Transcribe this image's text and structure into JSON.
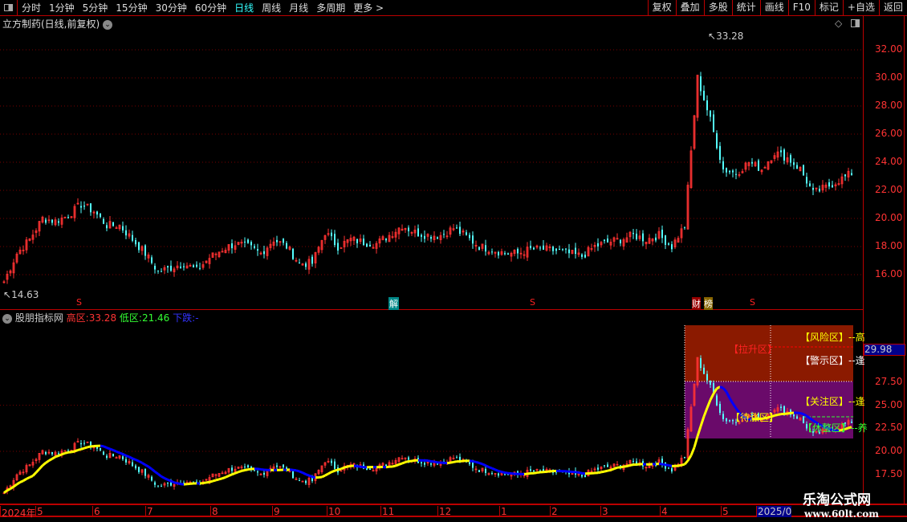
{
  "toolbar": {
    "periods": [
      "分时",
      "1分钟",
      "5分钟",
      "15分钟",
      "30分钟",
      "60分钟",
      "日线",
      "周线",
      "月线",
      "多周期",
      "更多 >"
    ],
    "active": "日线",
    "buttons": [
      "复权",
      "叠加",
      "多股",
      "统计",
      "画线",
      "F10",
      "标记",
      "+自选",
      "返回"
    ]
  },
  "main": {
    "title": "立方制药(日线,前复权)",
    "high_label": "33.28",
    "low_label": "14.63",
    "y_ticks": [
      "32.00",
      "30.00",
      "28.00",
      "26.00",
      "24.00",
      "22.00",
      "20.00",
      "18.00",
      "16.00"
    ],
    "markers": [
      "S",
      "解",
      "S",
      "财",
      "榜",
      "S"
    ]
  },
  "indicator": {
    "name": "股朋指标网",
    "high_label": "高区:",
    "high_value": "33.28",
    "low_label": "低区:",
    "low_value": "21.46",
    "down_label": "下跌:",
    "down_value": "-",
    "y_ticks": [
      "27.50",
      "25.00",
      "22.50",
      "20.00",
      "17.50"
    ],
    "current_value": "29.98",
    "zones": {
      "risk": "【风险区】--高",
      "pull": "【拉升区】",
      "warn": "【警示区】--逢",
      "watch": "【关注区】--逢",
      "wait": "【待涨区】",
      "rest": "【休整区】--养"
    }
  },
  "time_axis": [
    "2024年",
    "5",
    "6",
    "7",
    "8",
    "9",
    "10",
    "11",
    "12",
    "1",
    "2",
    "3",
    "4",
    "5",
    "2025/0"
  ],
  "watermark": {
    "name": "乐淘公式网",
    "url": "www.60lt.com"
  },
  "chart_data": {
    "type": "candlestick",
    "sampled_close": [
      15.5,
      17.5,
      18.5,
      20,
      19.8,
      20.2,
      21,
      20.5,
      19.5,
      19.5,
      18.5,
      17.5,
      16.2,
      16.5,
      16.8,
      16.3,
      17.2,
      17.8,
      18.2,
      18,
      17.5,
      18.5,
      18,
      16.8,
      16.8,
      19,
      18,
      18.5,
      18.3,
      18.2,
      18.8,
      19.5,
      19,
      18.8,
      18.8,
      19.3,
      18.7,
      18,
      17.8,
      17.5,
      17.5,
      17.8,
      17.8,
      17.7,
      17.5,
      17.3,
      18,
      18.3,
      18.5,
      18.8,
      18.5,
      18.8,
      18,
      19.5,
      30,
      27,
      23.5,
      23.2,
      24,
      23.5,
      24.7,
      24.3,
      23.5,
      21.8,
      22.2,
      22.7,
      23.2
    ],
    "high": 33.28,
    "low": 14.63
  },
  "colors": {
    "up": "#ff3232",
    "down": "#54ffff",
    "ma_up": "#ffff00",
    "ma_down": "#0000ff",
    "risk_zone": "#8b1a00",
    "watch_zone": "#6a0a6a"
  }
}
